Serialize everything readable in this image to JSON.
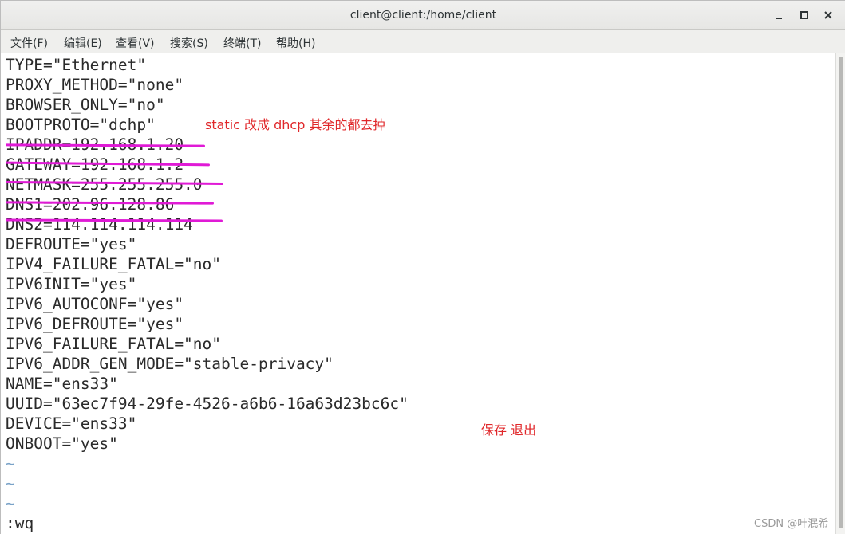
{
  "window": {
    "title": "client@client:/home/client"
  },
  "menu": [
    "文件(F)",
    "编辑(E)",
    "查看(V)",
    "搜索(S)",
    "终端(T)",
    "帮助(H)"
  ],
  "lines": [
    "TYPE=\"Ethernet\"",
    "PROXY_METHOD=\"none\"",
    "BROWSER_ONLY=\"no\"",
    "BOOTPROTO=\"dchp\"",
    "IPADDR=192.168.1.20",
    "GATEWAY=192.168.1.2",
    "NETMASK=255.255.255.0",
    "DNS1=202.96.128.86",
    "DNS2=114.114.114.114",
    "DEFROUTE=\"yes\"",
    "IPV4_FAILURE_FATAL=\"no\"",
    "IPV6INIT=\"yes\"",
    "IPV6_AUTOCONF=\"yes\"",
    "IPV6_DEFROUTE=\"yes\"",
    "IPV6_FAILURE_FATAL=\"no\"",
    "IPV6_ADDR_GEN_MODE=\"stable-privacy\"",
    "NAME=\"ens33\"",
    "UUID=\"63ec7f94-29fe-4526-a6b6-16a63d23bc6c\"",
    "DEVICE=\"ens33\"",
    "ONBOOT=\"yes\"",
    "~",
    "~",
    "~"
  ],
  "command_line": ":wq",
  "annotations": {
    "bootproto_note": "static 改成 dhcp 其余的都去掉",
    "save_note": "保存 退出"
  },
  "strikethrough_lines": [
    "IPADDR",
    "GATEWAY",
    "NETMASK",
    "DNS1",
    "DNS2"
  ],
  "colors": {
    "strike": "#e01ad6",
    "annotation": "#e0272a",
    "tilde": "#7aa3c8"
  },
  "watermark": "CSDN @叶泯希"
}
